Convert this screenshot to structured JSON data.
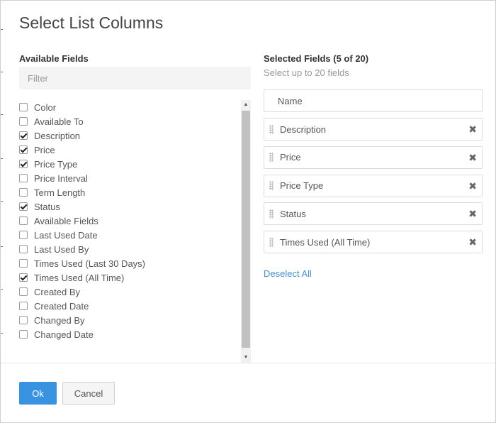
{
  "dialog": {
    "title": "Select List Columns"
  },
  "available": {
    "heading": "Available Fields",
    "filter_placeholder": "Filter",
    "fields": [
      {
        "label": "Color",
        "checked": false
      },
      {
        "label": "Available To",
        "checked": false
      },
      {
        "label": "Description",
        "checked": true
      },
      {
        "label": "Price",
        "checked": true
      },
      {
        "label": "Price Type",
        "checked": true
      },
      {
        "label": "Price Interval",
        "checked": false
      },
      {
        "label": "Term Length",
        "checked": false
      },
      {
        "label": "Status",
        "checked": true
      },
      {
        "label": "Available Fields",
        "checked": false
      },
      {
        "label": "Last Used Date",
        "checked": false
      },
      {
        "label": "Last Used By",
        "checked": false
      },
      {
        "label": "Times Used (Last 30 Days)",
        "checked": false
      },
      {
        "label": "Times Used (All Time)",
        "checked": true
      },
      {
        "label": "Created By",
        "checked": false
      },
      {
        "label": "Created Date",
        "checked": false
      },
      {
        "label": "Changed By",
        "checked": false
      },
      {
        "label": "Changed Date",
        "checked": false
      }
    ]
  },
  "selected": {
    "heading": "Selected Fields (5 of 20)",
    "helper": "Select up to 20 fields",
    "fixed_field": "Name",
    "items": [
      "Description",
      "Price",
      "Price Type",
      "Status",
      "Times Used (All Time)"
    ],
    "remove_glyph": "✖",
    "deselect_all": "Deselect All"
  },
  "scrollbar": {
    "up_glyph": "▲",
    "down_glyph": "▼"
  },
  "footer": {
    "ok_label": "Ok",
    "cancel_label": "Cancel"
  },
  "colors": {
    "primary": "#3a93e0",
    "link": "#4a90c8"
  }
}
